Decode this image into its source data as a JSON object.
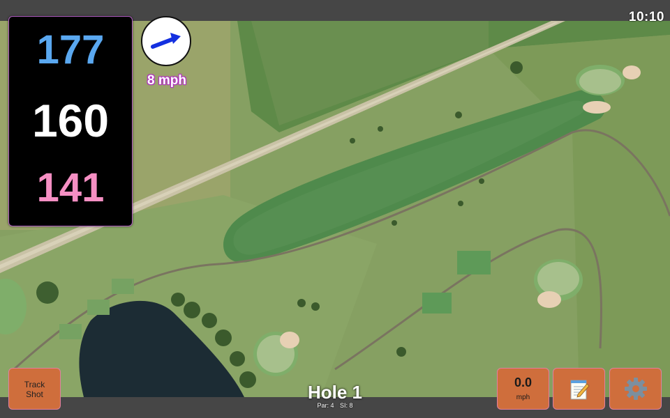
{
  "status": {
    "time": "10:10"
  },
  "distances": {
    "back": "177",
    "middle": "160",
    "front": "141",
    "back_color": "#5aa8f0",
    "middle_color": "#ffffff",
    "front_color": "#f58fc3"
  },
  "wind": {
    "speed_label": "8 mph",
    "direction_icon": "arrow-icon"
  },
  "buttons": {
    "track_shot_line1": "Track",
    "track_shot_line2": "Shot",
    "speed_value": "0.0",
    "speed_unit": "mph",
    "notes_icon": "notepad-icon",
    "settings_icon": "gear-icon"
  },
  "hole": {
    "title": "Hole 1",
    "par": "Par: 4",
    "stroke_index": "SI: 8"
  },
  "colors": {
    "button_bg": "#cf6e3c",
    "button_border": "#e07fa0",
    "panel_border": "#b35fc4"
  }
}
